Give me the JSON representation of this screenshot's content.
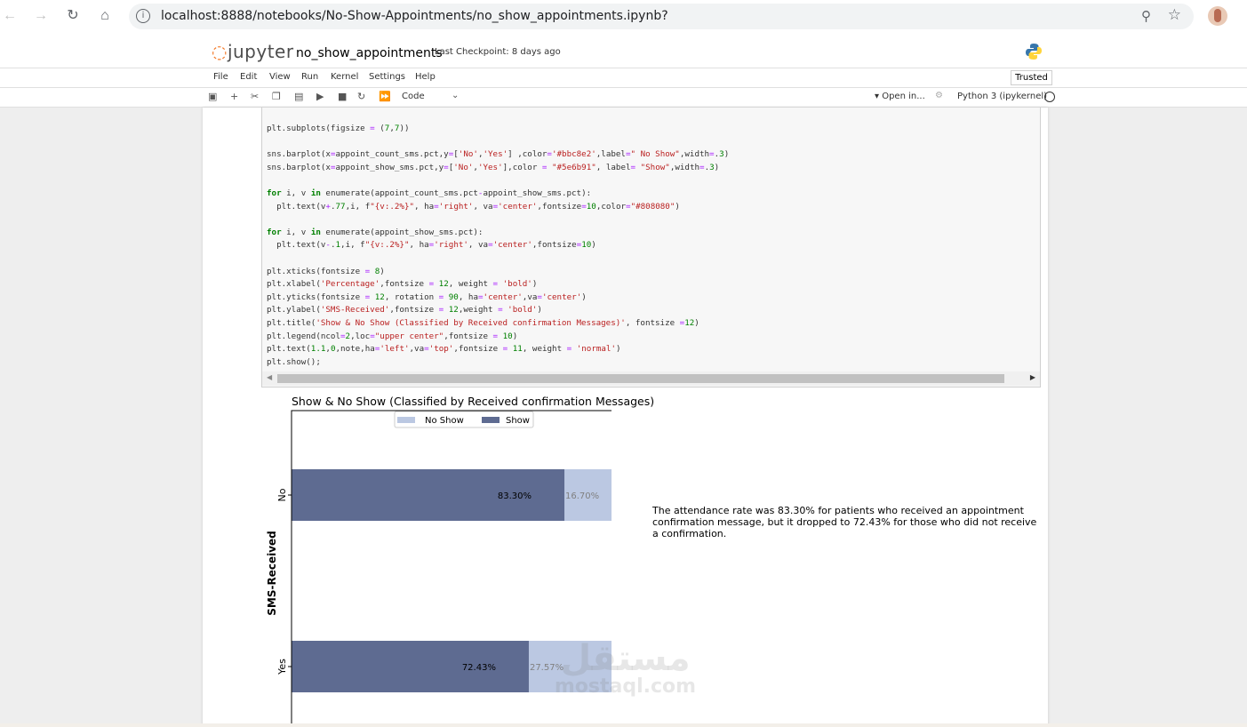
{
  "browser": {
    "url": "localhost:8888/notebooks/No-Show-Appointments/no_show_appointments.ipynb?"
  },
  "jupyter": {
    "logo_text": "jupyter",
    "notebook_name": "no_show_appointments",
    "checkpoint": "Last Checkpoint: 8 days ago",
    "menu": [
      "File",
      "Edit",
      "View",
      "Run",
      "Kernel",
      "Settings",
      "Help"
    ],
    "trusted": "Trusted",
    "cell_type": "Code",
    "open_in": "Open in...",
    "kernel": "Python 3 (ipykernel)"
  },
  "code_lines": [
    "plt.subplots(figsize = (7,7))",
    "",
    "sns.barplot(x=appoint_count_sms.pct,y=['No','Yes'] ,color='#bbc8e2',label=\" No Show\",width=.3)",
    "sns.barplot(x=appoint_show_sms.pct,y=['No','Yes'],color = \"#5e6b91\", label= \"Show\",width=.3)",
    "",
    "for i, v in enumerate(appoint_count_sms.pct-appoint_show_sms.pct):",
    "  plt.text(v+.77,i, f\"{v:.2%}\", ha='right', va='center',fontsize=10,color=\"#808080\")",
    "",
    "for i, v in enumerate(appoint_show_sms.pct):",
    "  plt.text(v-.1,i, f\"{v:.2%}\", ha='right', va='center',fontsize=10)",
    "",
    "plt.xticks(fontsize = 8)",
    "plt.xlabel('Percentage',fontsize = 12, weight = 'bold')",
    "plt.yticks(fontsize = 12, rotation = 90, ha='center',va='center')",
    "plt.ylabel('SMS-Received',fontsize = 12,weight = 'bold')",
    "plt.title('Show & No Show (Classified by Received confirmation Messages)', fontsize =12)",
    "plt.legend(ncol=2,loc=\"upper center\",fontsize = 10)",
    "plt.text(1.1,0,note,ha='left',va='top',fontsize = 11, weight = 'normal')",
    "plt.show();"
  ],
  "chart_data": {
    "type": "bar",
    "orientation": "horizontal",
    "title": "Show & No Show (Classified by Received confirmation Messages)",
    "ylabel": "SMS-Received",
    "xlabel": "",
    "categories": [
      "No",
      "Yes"
    ],
    "series": [
      {
        "name": "No Show",
        "color": "#bbc8e2",
        "values": [
          1.0,
          1.0
        ],
        "labels": [
          "16.70%",
          "27.57%"
        ]
      },
      {
        "name": "Show",
        "color": "#5e6b91",
        "values": [
          0.833,
          0.7243
        ],
        "labels": [
          "83.30%",
          "72.43%"
        ]
      }
    ],
    "xlim": [
      0,
      1.05
    ],
    "legend": "upper center",
    "note": "The attendance rate was 83.30% for patients who received an appointment confirmation message, but it dropped to 72.43% for those who did not receive a confirmation."
  },
  "watermark": {
    "arabic": "مستقل",
    "latin": "mostaql.com"
  }
}
